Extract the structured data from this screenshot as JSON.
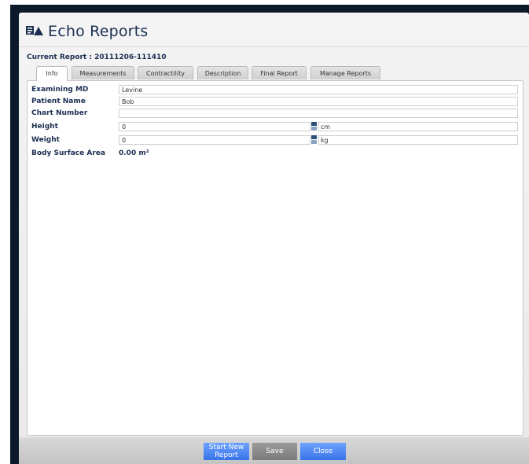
{
  "app": {
    "title": "Echo Reports",
    "current_report_label": "Current Report : 20111206-111410"
  },
  "tabs": [
    {
      "label": "Info",
      "active": true
    },
    {
      "label": "Measurements",
      "active": false
    },
    {
      "label": "Contractility",
      "active": false
    },
    {
      "label": "Description",
      "active": false
    },
    {
      "label": "Final Report",
      "active": false
    },
    {
      "label": "Manage Reports",
      "active": false
    }
  ],
  "info": {
    "examining_md": {
      "label": "Examining MD",
      "value": "Levine"
    },
    "patient_name": {
      "label": "Patient Name",
      "value": "Bob"
    },
    "chart_number": {
      "label": "Chart Number",
      "value": ""
    },
    "height": {
      "label": "Height",
      "value": "0",
      "unit": "cm"
    },
    "weight": {
      "label": "Weight",
      "value": "0",
      "unit": "kg"
    },
    "bsa": {
      "label": "Body Surface Area",
      "value": "0.00 m²"
    }
  },
  "footer": {
    "start_new_report": "Start New Report",
    "save": "Save",
    "close": "Close"
  },
  "colors": {
    "accent_blue": "#3874e8",
    "title_text": "#1b2f52",
    "window_frame": "#0d1a2a"
  },
  "icons": {
    "app_icon": "report-chart-icon"
  }
}
